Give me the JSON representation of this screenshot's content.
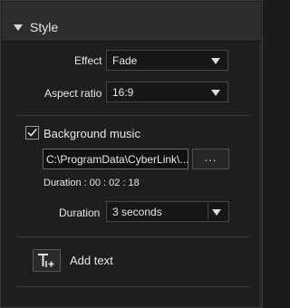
{
  "panel": {
    "title": "Style"
  },
  "effect": {
    "label": "Effect",
    "value": "Fade"
  },
  "aspect_ratio": {
    "label": "Aspect ratio",
    "value": "16:9"
  },
  "background_music": {
    "label": "Background music",
    "checked": true,
    "path_value": "C:\\ProgramData\\CyberLink\\...",
    "browse_label": "...",
    "duration_text": "Duration : 00 : 02 : 18"
  },
  "duration": {
    "label": "Duration",
    "value": "3 seconds"
  },
  "add_text": {
    "label": "Add text",
    "icon": "add-text-icon"
  },
  "colors": {
    "background": "#1e1e1e",
    "header": "#2d2d2d",
    "text": "#e8e8e8"
  }
}
